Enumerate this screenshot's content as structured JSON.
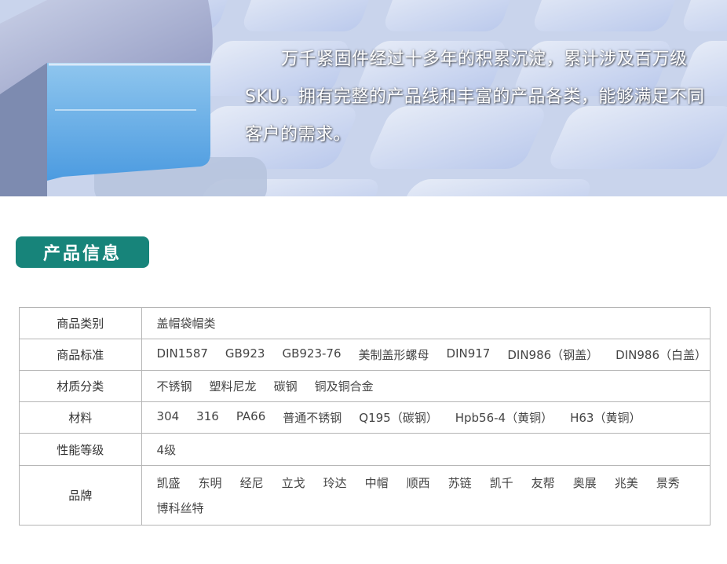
{
  "banner": {
    "text": "万千紧固件经过十多年的积累沉淀，累计涉及百万级SKU。拥有完整的产品线和丰富的产品各类，能够满足不同客户的需求。"
  },
  "section": {
    "title": "产品信息"
  },
  "table": {
    "category": {
      "label": "商品类别",
      "value": "盖帽袋帽类"
    },
    "standard": {
      "label": "商品标准",
      "items": [
        "DIN1587",
        "GB923",
        "GB923-76",
        "美制盖形螺母",
        "DIN917",
        "DIN986（钢盖）",
        "DIN986（白盖）"
      ]
    },
    "material_type": {
      "label": "材质分类",
      "items": [
        "不锈钢",
        "塑料尼龙",
        "碳钢",
        "铜及铜合金"
      ]
    },
    "material": {
      "label": "材料",
      "items": [
        "304",
        "316",
        "PA66",
        "普通不锈钢",
        "Q195（碳钢）",
        "Hpb56-4（黄铜）",
        "H63（黄铜）"
      ]
    },
    "grade": {
      "label": "性能等级",
      "value": "4级"
    },
    "brand": {
      "label": "品牌",
      "items": [
        "凯盛",
        "东明",
        "经尼",
        "立戈",
        "玲达",
        "中帽",
        "顺西",
        "苏链",
        "凯千",
        "友帮",
        "奥展",
        "兆美",
        "景秀",
        "博科丝特"
      ]
    }
  },
  "colors": {
    "title_bg": "#17847a",
    "border": "#b5b5b5"
  }
}
